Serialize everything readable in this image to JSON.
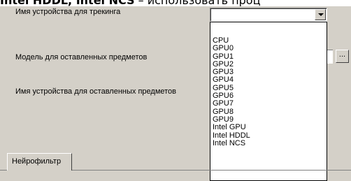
{
  "header": {
    "bold_text": "Intel HDDL, Intel NCS",
    "rest_text": " – использовать проц"
  },
  "form": {
    "tracking_device_label": "Имя устройства для трекинга",
    "tracking_device_value": "",
    "abandoned_model_label": "Модель для оставленных предметов",
    "abandoned_device_label": "Имя устройства для оставленных предметов",
    "browse_button_label": "..."
  },
  "dropdown": {
    "options": [
      "CPU",
      "GPU0",
      "GPU1",
      "GPU2",
      "GPU3",
      "GPU4",
      "GPU5",
      "GPU6",
      "GPU7",
      "GPU8",
      "GPU9",
      "Intel GPU",
      "Intel HDDL",
      "Intel NCS"
    ]
  },
  "tabs": {
    "active_label": "Нейрофильтр"
  }
}
